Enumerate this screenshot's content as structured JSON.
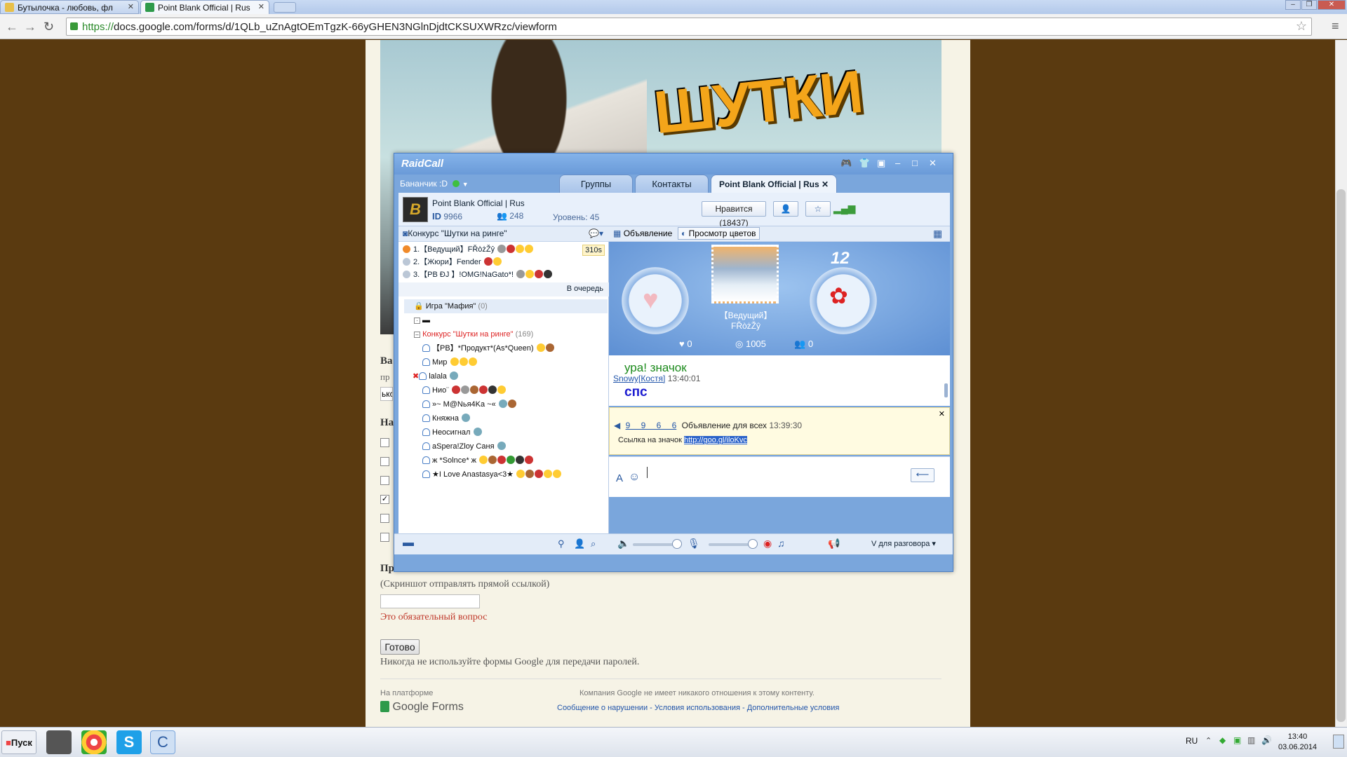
{
  "browser": {
    "tabs": [
      {
        "label": "Бутылочка - любовь, фл"
      },
      {
        "label": "Point Blank Official | Rus"
      }
    ],
    "url_scheme": "https://",
    "url_rest": "docs.google.com/forms/d/1QLb_uZnAgtOEmTgzK-66yGHEN3NGlnDjdtCKSUXWRzc/viewform"
  },
  "banner": {
    "word": "ШУТКИ"
  },
  "form": {
    "q_label_frag": "Ва",
    "q_sub_frag": "пр",
    "q_input_frag": "ькс",
    "q2_frag": "На",
    "bottom_question": "Пр",
    "bottom_hint": "(Скриншот отправлять прямой ссылкой)",
    "required": "Это обязательный вопрос",
    "submit": "Готово",
    "password_note": "Никогда не используйте формы Google для передачи паролей.",
    "powered_by": "На платформе",
    "google_forms": "Google Forms",
    "disclaimer": "Компания Google не имеет никакого отношения к этому контенту.",
    "links": "Сообщение о нарушении - Условия использования - Дополнительные условия"
  },
  "raidcall": {
    "logo": "RaidCall",
    "user": "Бананчик :D",
    "tabs": {
      "groups": "Группы",
      "contacts": "Контакты",
      "channel": "Point Blank Official | Rus"
    },
    "group_name": "Point Blank Official | Rus",
    "id_label": "ID",
    "id": "9966",
    "members": "248",
    "level": "Уровень: 45",
    "likes_button": "Нравится (18437)",
    "left_header": "Конкурс \"Шутки на ринге\"",
    "mics": [
      {
        "text": "1.【Ведущий】FŘòżŽŷ",
        "timer": "310s"
      },
      {
        "text": "2.【Жюри】Fender"
      },
      {
        "text": "3.【PB ĐJ 】!OMG!NaGato*!"
      }
    ],
    "queue": "В очередь",
    "tree": {
      "mafia": "Игра \"Мафия\"",
      "mafia_count": "(0)",
      "contest": "Конкурс \"Шутки на ринге\"",
      "contest_count": "(169)",
      "users": [
        "【PB】*Продукт*(As*Queen)",
        "Мир",
        "lalala",
        "Нио¨",
        "»~ M@Nья4Ka ~«",
        "Княжна",
        "Неосигнал",
        "aSpera!Zloy Саня",
        "ж *Solnce* ж",
        "★I Love Anastasya<3★"
      ]
    },
    "stage_bar": {
      "announce": "Объявление",
      "colors": "Просмотр цветов"
    },
    "stage": {
      "host": "【Ведущий】FŘòżŽŷ",
      "countdown": "12",
      "hearts": "0",
      "coins": "1005",
      "people": "0"
    },
    "chat": [
      {
        "text": "ура! значок"
      },
      {
        "user": "Snowy[Костя]",
        "time": "13:40:01",
        "text": "спс"
      }
    ],
    "announcement": {
      "id": "9 9 6 6",
      "title": "Объявление для всех",
      "time": "13:39:30",
      "label": "Ссылка на значок",
      "link": "http://goo.gl/iloKvc"
    },
    "voice_mode": "V для разговора"
  },
  "taskbar": {
    "start": "Пуск",
    "lang": "RU",
    "time": "13:40",
    "date": "03.06.2014"
  }
}
